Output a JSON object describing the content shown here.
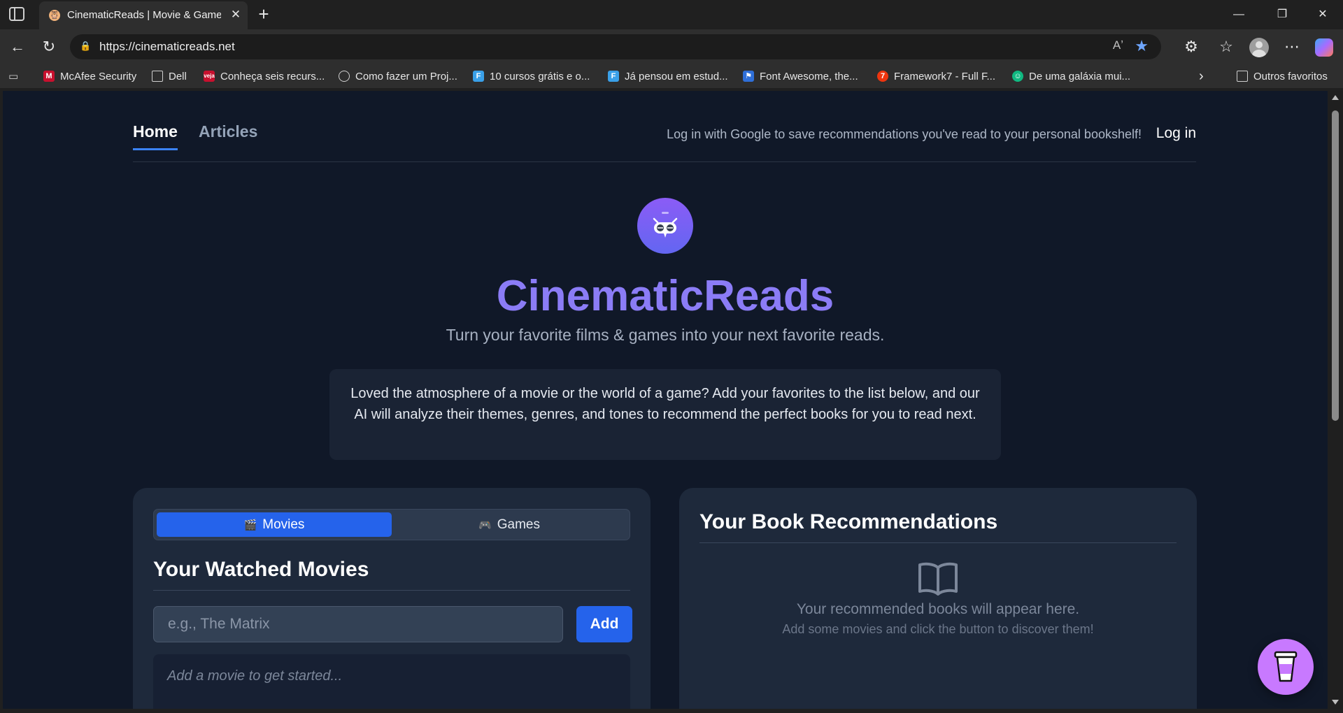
{
  "browser": {
    "tab_title": "CinematicReads | Movie & Game-",
    "url": "https://cinematicreads.net",
    "read_aloud": "Aʼ",
    "bookmarks": [
      {
        "label": "McAfee Security",
        "icon": "mcafee-shield-icon",
        "color": "#c8102e"
      },
      {
        "label": "Dell",
        "icon": "folder-icon",
        "color": ""
      },
      {
        "label": "Conheça seis recurs...",
        "icon": "veja-icon",
        "color": "#c8102e"
      },
      {
        "label": "Como fazer um Proj...",
        "icon": "globe-icon",
        "color": ""
      },
      {
        "label": "10 cursos grátis e o...",
        "icon": "flag-icon",
        "color": "#3aa0e8"
      },
      {
        "label": "Já pensou em estud...",
        "icon": "flag-icon",
        "color": "#3aa0e8"
      },
      {
        "label": "Font Awesome, the...",
        "icon": "font-awesome-flag-icon",
        "color": "#2f6fd8"
      },
      {
        "label": "Framework7 - Full F...",
        "icon": "framework7-icon",
        "color": "#ee350f"
      },
      {
        "label": "De uma galáxia mui...",
        "icon": "robot-icon",
        "color": "#10b981"
      }
    ],
    "other_favorites": "Outros favoritos"
  },
  "nav": {
    "home": "Home",
    "articles": "Articles",
    "login_hint": "Log in with Google to save recommendations you've read to your personal bookshelf!",
    "login": "Log in"
  },
  "hero": {
    "title": "CinematicReads",
    "subtitle": "Turn your favorite films & games into your next favorite reads.",
    "intro": "Loved the atmosphere of a movie or the world of a game? Add your favorites to the list below, and our AI will analyze their themes, genres, and tones to recommend the perfect books for you to read next."
  },
  "watched": {
    "tab_movies": "Movies",
    "tab_games": "Games",
    "heading": "Your Watched Movies",
    "input_placeholder": "e.g., The Matrix",
    "add_label": "Add",
    "empty": "Add a movie to get started..."
  },
  "recommendations": {
    "heading": "Your Book Recommendations",
    "empty": "Your recommended books will appear here.",
    "hint": "Add some movies and click the button to discover them!"
  },
  "colors": {
    "page_bg": "#101828",
    "card_bg": "#1e293b",
    "accent_blue": "#2563eb",
    "brand_purple": "#8b7cf6",
    "coffee_button": "#c879ff"
  }
}
